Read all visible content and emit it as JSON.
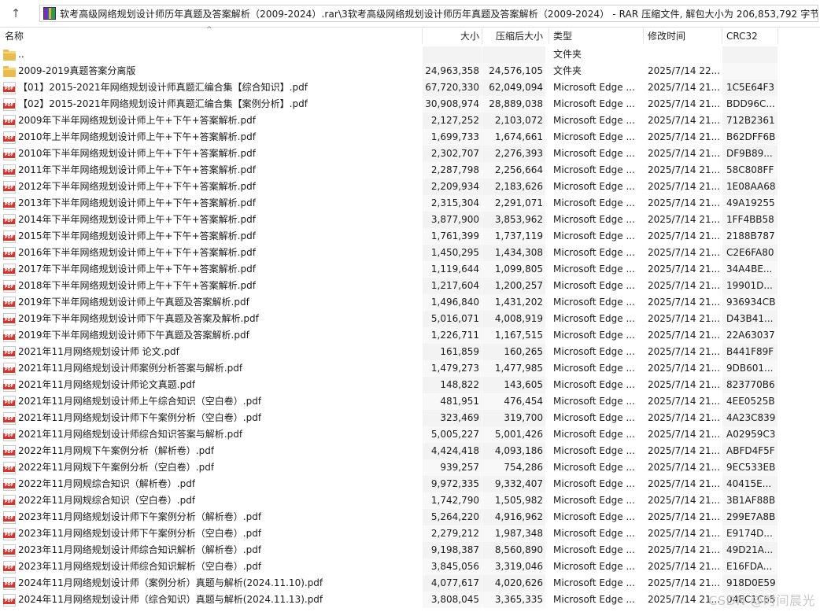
{
  "address_bar": {
    "up_icon": "arrow-up-icon",
    "path": "软考高级网络规划设计师历年真题及答案解析（2009-2024）.rar\\3软考高级网络规划设计师历年真题及答案解析（2009-2024） - RAR 压缩文件, 解包大小为 206,853,792 字节"
  },
  "columns": {
    "name": "名称",
    "size": "大小",
    "packed": "压缩后大小",
    "type": "类型",
    "modified": "修改时间",
    "crc": "CRC32"
  },
  "rows": [
    {
      "icon": "folder",
      "name": "..",
      "size": "",
      "packed": "",
      "type": "文件夹",
      "modified": "",
      "crc": ""
    },
    {
      "icon": "folder",
      "name": "2009-2019真题答案分离版",
      "size": "24,963,358",
      "packed": "24,576,105",
      "type": "文件夹",
      "modified": "2025/7/14 22...",
      "crc": ""
    },
    {
      "icon": "pdf",
      "name": "【01】2015-2021年网络规划设计师真题汇编合集【综合知识】.pdf",
      "size": "67,720,330",
      "packed": "62,049,094",
      "type": "Microsoft Edge ...",
      "modified": "2025/7/14 21...",
      "crc": "1C5E64F3"
    },
    {
      "icon": "pdf",
      "name": "【02】2015-2021年网络规划设计师真题汇编合集【案例分析】.pdf",
      "size": "30,908,974",
      "packed": "28,889,038",
      "type": "Microsoft Edge ...",
      "modified": "2025/7/14 21...",
      "crc": "BDD96C..."
    },
    {
      "icon": "pdf",
      "name": "2009年下半年网络规划设计师上午+下午+答案解析.pdf",
      "size": "2,127,252",
      "packed": "2,103,072",
      "type": "Microsoft Edge ...",
      "modified": "2025/7/14 21...",
      "crc": "712B2361"
    },
    {
      "icon": "pdf",
      "name": "2010年上半年网络规划设计师上午+下午+答案解析.pdf",
      "size": "1,699,733",
      "packed": "1,674,661",
      "type": "Microsoft Edge ...",
      "modified": "2025/7/14 21...",
      "crc": "B62DFF6B"
    },
    {
      "icon": "pdf",
      "name": "2010年下半年网络规划设计师上午+下午+答案解析.pdf",
      "size": "2,302,707",
      "packed": "2,276,393",
      "type": "Microsoft Edge ...",
      "modified": "2025/7/14 21...",
      "crc": "DF9B89..."
    },
    {
      "icon": "pdf",
      "name": "2011年下半年网络规划设计师上午+下午+答案解析.pdf",
      "size": "2,287,798",
      "packed": "2,256,664",
      "type": "Microsoft Edge ...",
      "modified": "2025/7/14 21...",
      "crc": "58C808FF"
    },
    {
      "icon": "pdf",
      "name": "2012年下半年网络规划设计师上午+下午+答案解析.pdf",
      "size": "2,209,934",
      "packed": "2,183,626",
      "type": "Microsoft Edge ...",
      "modified": "2025/7/14 21...",
      "crc": "1E08AA68"
    },
    {
      "icon": "pdf",
      "name": "2013年下半年网络规划设计师上午+下午+答案解析.pdf",
      "size": "2,315,304",
      "packed": "2,291,071",
      "type": "Microsoft Edge ...",
      "modified": "2025/7/14 21...",
      "crc": "49A19255"
    },
    {
      "icon": "pdf",
      "name": "2014年下半年网络规划设计师上午+下午+答案解析.pdf",
      "size": "3,877,900",
      "packed": "3,853,962",
      "type": "Microsoft Edge ...",
      "modified": "2025/7/14 21...",
      "crc": "1FF4BB58"
    },
    {
      "icon": "pdf",
      "name": "2015年下半年网络规划设计师上午+下午+答案解析.pdf",
      "size": "1,761,399",
      "packed": "1,737,119",
      "type": "Microsoft Edge ...",
      "modified": "2025/7/14 21...",
      "crc": "2188B787"
    },
    {
      "icon": "pdf",
      "name": "2016年下半年网络规划设计师上午+下午+答案解析.pdf",
      "size": "1,450,295",
      "packed": "1,434,308",
      "type": "Microsoft Edge ...",
      "modified": "2025/7/14 21...",
      "crc": "C2E6FA80"
    },
    {
      "icon": "pdf",
      "name": "2017年下半年网络规划设计师上午+下午+答案解析.pdf",
      "size": "1,119,644",
      "packed": "1,099,805",
      "type": "Microsoft Edge ...",
      "modified": "2025/7/14 21...",
      "crc": "34A4BE..."
    },
    {
      "icon": "pdf",
      "name": "2018年下半年网络规划设计师上午+下午+答案解析.pdf",
      "size": "1,217,604",
      "packed": "1,200,257",
      "type": "Microsoft Edge ...",
      "modified": "2025/7/14 21...",
      "crc": "19901D..."
    },
    {
      "icon": "pdf",
      "name": "2019年下半年网络规划设计师上午真题及答案解析.pdf",
      "size": "1,496,840",
      "packed": "1,431,202",
      "type": "Microsoft Edge ...",
      "modified": "2025/7/14 21...",
      "crc": "936934CB"
    },
    {
      "icon": "pdf",
      "name": "2019年下半年网络规划设计师下午真题及答案及解析.pdf",
      "size": "5,016,071",
      "packed": "4,008,919",
      "type": "Microsoft Edge ...",
      "modified": "2025/7/14 21...",
      "crc": "D43B41..."
    },
    {
      "icon": "pdf",
      "name": "2019年下半年网络规划设计师下午真题及答案解析.pdf",
      "size": "1,226,711",
      "packed": "1,167,515",
      "type": "Microsoft Edge ...",
      "modified": "2025/7/14 21...",
      "crc": "22A63037"
    },
    {
      "icon": "pdf",
      "name": "2021年11月网络规划设计师 论文.pdf",
      "size": "161,859",
      "packed": "160,265",
      "type": "Microsoft Edge ...",
      "modified": "2025/7/14 21...",
      "crc": "B441F89F"
    },
    {
      "icon": "pdf",
      "name": "2021年11月网络规划设计师案例分析答案与解析.pdf",
      "size": "1,479,273",
      "packed": "1,477,985",
      "type": "Microsoft Edge ...",
      "modified": "2025/7/14 21...",
      "crc": "9DB601..."
    },
    {
      "icon": "pdf",
      "name": "2021年11月网络规划设计师论文真题.pdf",
      "size": "148,822",
      "packed": "143,605",
      "type": "Microsoft Edge ...",
      "modified": "2025/7/14 21...",
      "crc": "823770B6"
    },
    {
      "icon": "pdf",
      "name": "2021年11月网络规划设计师上午综合知识（空白卷）.pdf",
      "size": "481,951",
      "packed": "476,454",
      "type": "Microsoft Edge ...",
      "modified": "2025/7/14 21...",
      "crc": "4EE0525B"
    },
    {
      "icon": "pdf",
      "name": "2021年11月网络规划设计师下午案例分析（空白卷）.pdf",
      "size": "323,469",
      "packed": "319,700",
      "type": "Microsoft Edge ...",
      "modified": "2025/7/14 21...",
      "crc": "4A23C839"
    },
    {
      "icon": "pdf",
      "name": "2021年11月网络规划设计师综合知识答案与解析.pdf",
      "size": "5,005,227",
      "packed": "5,001,426",
      "type": "Microsoft Edge ...",
      "modified": "2025/7/14 21...",
      "crc": "A02959C3"
    },
    {
      "icon": "pdf",
      "name": "2022年11月网规下午案例分析（解析卷）.pdf",
      "size": "4,424,418",
      "packed": "4,093,186",
      "type": "Microsoft Edge ...",
      "modified": "2025/7/14 21...",
      "crc": "ABFD4F5F"
    },
    {
      "icon": "pdf",
      "name": "2022年11月网规下午案例分析（空白卷）.pdf",
      "size": "939,257",
      "packed": "754,286",
      "type": "Microsoft Edge ...",
      "modified": "2025/7/14 21...",
      "crc": "9EC533EB"
    },
    {
      "icon": "pdf",
      "name": "2022年11月网规综合知识（解析卷）.pdf",
      "size": "9,972,335",
      "packed": "9,332,407",
      "type": "Microsoft Edge ...",
      "modified": "2025/7/14 21...",
      "crc": "40415E..."
    },
    {
      "icon": "pdf",
      "name": "2022年11月网规综合知识（空白卷）.pdf",
      "size": "1,742,790",
      "packed": "1,505,982",
      "type": "Microsoft Edge ...",
      "modified": "2025/7/14 21...",
      "crc": "3B1AF88B"
    },
    {
      "icon": "pdf",
      "name": "2023年11月网络规划设计师下午案例分析（解析卷）.pdf",
      "size": "5,264,220",
      "packed": "4,916,962",
      "type": "Microsoft Edge ...",
      "modified": "2025/7/14 21...",
      "crc": "299E7A8B"
    },
    {
      "icon": "pdf",
      "name": "2023年11月网络规划设计师下午案例分析（空白卷）.pdf",
      "size": "2,279,212",
      "packed": "1,987,348",
      "type": "Microsoft Edge ...",
      "modified": "2025/7/14 21...",
      "crc": "E9174D..."
    },
    {
      "icon": "pdf",
      "name": "2023年11月网络规划设计师综合知识解析（解析卷）.pdf",
      "size": "9,198,387",
      "packed": "8,560,890",
      "type": "Microsoft Edge ...",
      "modified": "2025/7/14 21...",
      "crc": "49D21A..."
    },
    {
      "icon": "pdf",
      "name": "2023年11月网络规划设计师综合知识解析（空白卷）.pdf",
      "size": "3,845,056",
      "packed": "3,319,046",
      "type": "Microsoft Edge ...",
      "modified": "2025/7/14 21...",
      "crc": "E16FDA..."
    },
    {
      "icon": "pdf",
      "name": "2024年11月网络规划设计师（案例分析）真题与解析(2024.11.10).pdf",
      "size": "4,077,617",
      "packed": "4,020,626",
      "type": "Microsoft Edge ...",
      "modified": "2025/7/14 21...",
      "crc": "918D0E59"
    },
    {
      "icon": "pdf",
      "name": "2024年11月网络规划设计师（综合知识）真题与解析(2024.11.13).pdf",
      "size": "3,808,045",
      "packed": "3,365,335",
      "type": "Microsoft Edge ...",
      "modified": "2025/7/14 21...",
      "crc": "04EC1C65"
    }
  ],
  "watermark": "CSDN @时间晨光",
  "colors": {
    "folder": "#e8bd4f",
    "pdf_badge": "#d6332b",
    "alt_row": "#f3f3f3"
  }
}
